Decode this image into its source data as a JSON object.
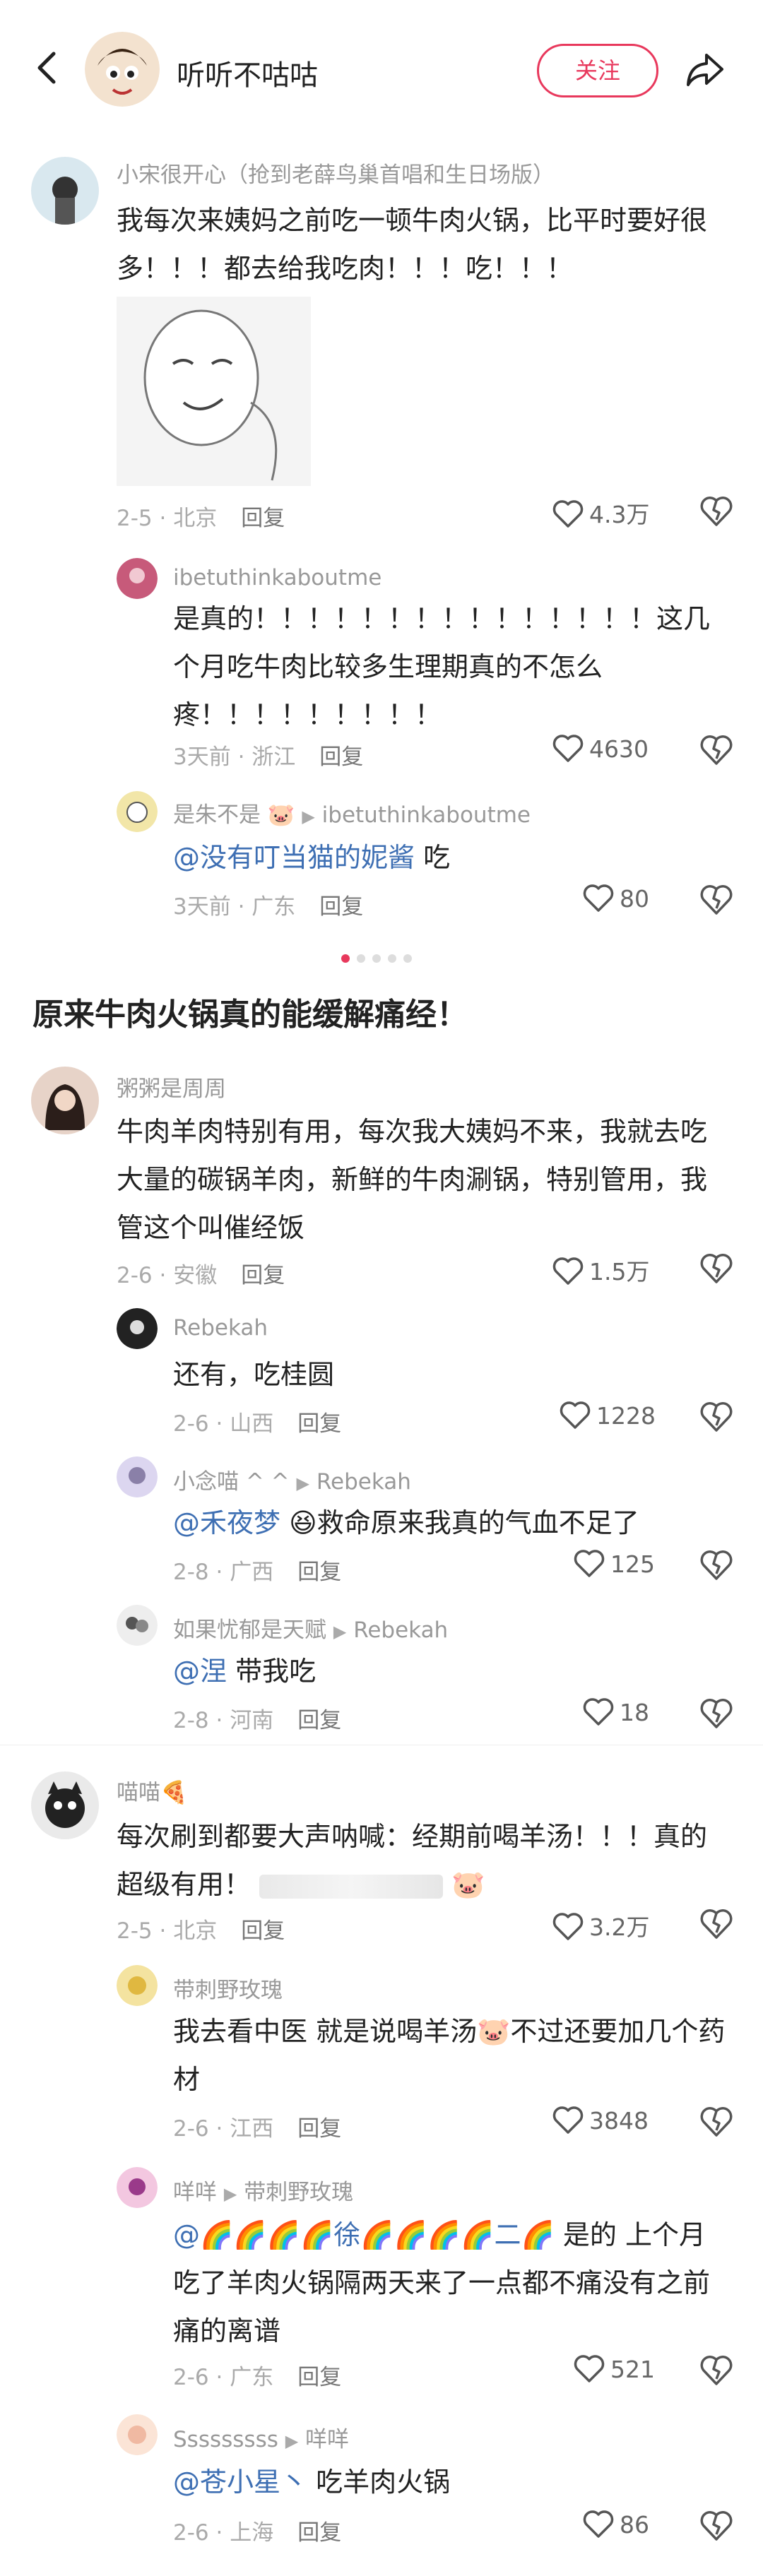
{
  "header": {
    "title": "听听不咕咕",
    "follow_label": "关注"
  },
  "section_title": "原来牛肉火锅真的能缓解痛经！",
  "carousel": {
    "page_count": 5,
    "active_index": 0
  },
  "comments": [
    {
      "name": "小宋很开心（抢到老薛鸟巢首唱和生日场版）",
      "text": "我每次来姨妈之前吃一顿牛肉火锅，比平时要好很多！！！都去给我吃肉！！！吃！！！",
      "time": "2-5 · 北京",
      "reply": "回复",
      "likes": "4.3万",
      "has_sticker": true
    },
    {
      "name": "ibetuthinkaboutme",
      "text": "是真的！！！！！！！！！！！！！！！这几个月吃牛肉比较多生理期真的不怎么疼！！！！！！！！！",
      "time": "3天前 · 浙江",
      "reply": "回复",
      "likes": "4630"
    },
    {
      "name": "是朱不是",
      "reply_to": "ibetuthinkaboutme",
      "mention": "@没有叮当猫的妮酱",
      "text": " 吃",
      "time": "3天前 · 广东",
      "reply": "回复",
      "likes": "80"
    },
    {
      "name": "粥粥是周周",
      "text": "牛肉羊肉特别有用，每次我大姨妈不来，我就去吃大量的碳锅羊肉，新鲜的牛肉涮锅，特别管用，我管这个叫催经饭",
      "time": "2-6 · 安徽",
      "reply": "回复",
      "likes": "1.5万"
    },
    {
      "name": "Rebekah",
      "text": "还有，吃桂圆",
      "time": "2-6 · 山西",
      "reply": "回复",
      "likes": "1228"
    },
    {
      "name": "小念喵 ^ ^",
      "reply_to": "Rebekah",
      "mention": "@禾夜梦",
      "text": " 😆救命原来我真的气血不足了",
      "time": "2-8 · 广西",
      "reply": "回复",
      "likes": "125"
    },
    {
      "name": "如果忧郁是天赋",
      "reply_to": "Rebekah",
      "mention": "@涅",
      "text": " 带我吃",
      "time": "2-8 · 河南",
      "reply": "回复",
      "likes": "18"
    },
    {
      "name": "喵喵🍕",
      "text": "每次刷到都要大声呐喊：经期前喝羊汤！！！真的超级有用！",
      "time": "2-5 · 北京",
      "reply": "回复",
      "likes": "3.2万"
    },
    {
      "name": "带刺野玫瑰",
      "text": "我去看中医 就是说喝羊汤🐷不过还要加几个药材",
      "time": "2-6 · 江西",
      "reply": "回复",
      "likes": "3848"
    },
    {
      "name": "咩咩",
      "reply_to": "带刺野玫瑰",
      "mention": "@🌈🌈🌈🌈徐🌈🌈🌈🌈二🌈",
      "text": " 是的 上个月吃了羊肉火锅隔两天来了一点都不痛没有之前痛的离谱",
      "time": "2-6 · 广东",
      "reply": "回复",
      "likes": "521"
    },
    {
      "name": "Sssssssss",
      "reply_to": "咩咩",
      "mention": "@苍小星丶",
      "text": " 吃羊肉火锅",
      "time": "2-6 · 上海",
      "reply": "回复",
      "likes": "86"
    }
  ],
  "colors": {
    "accent": "#e8385c",
    "mention": "#3e6fb3"
  }
}
